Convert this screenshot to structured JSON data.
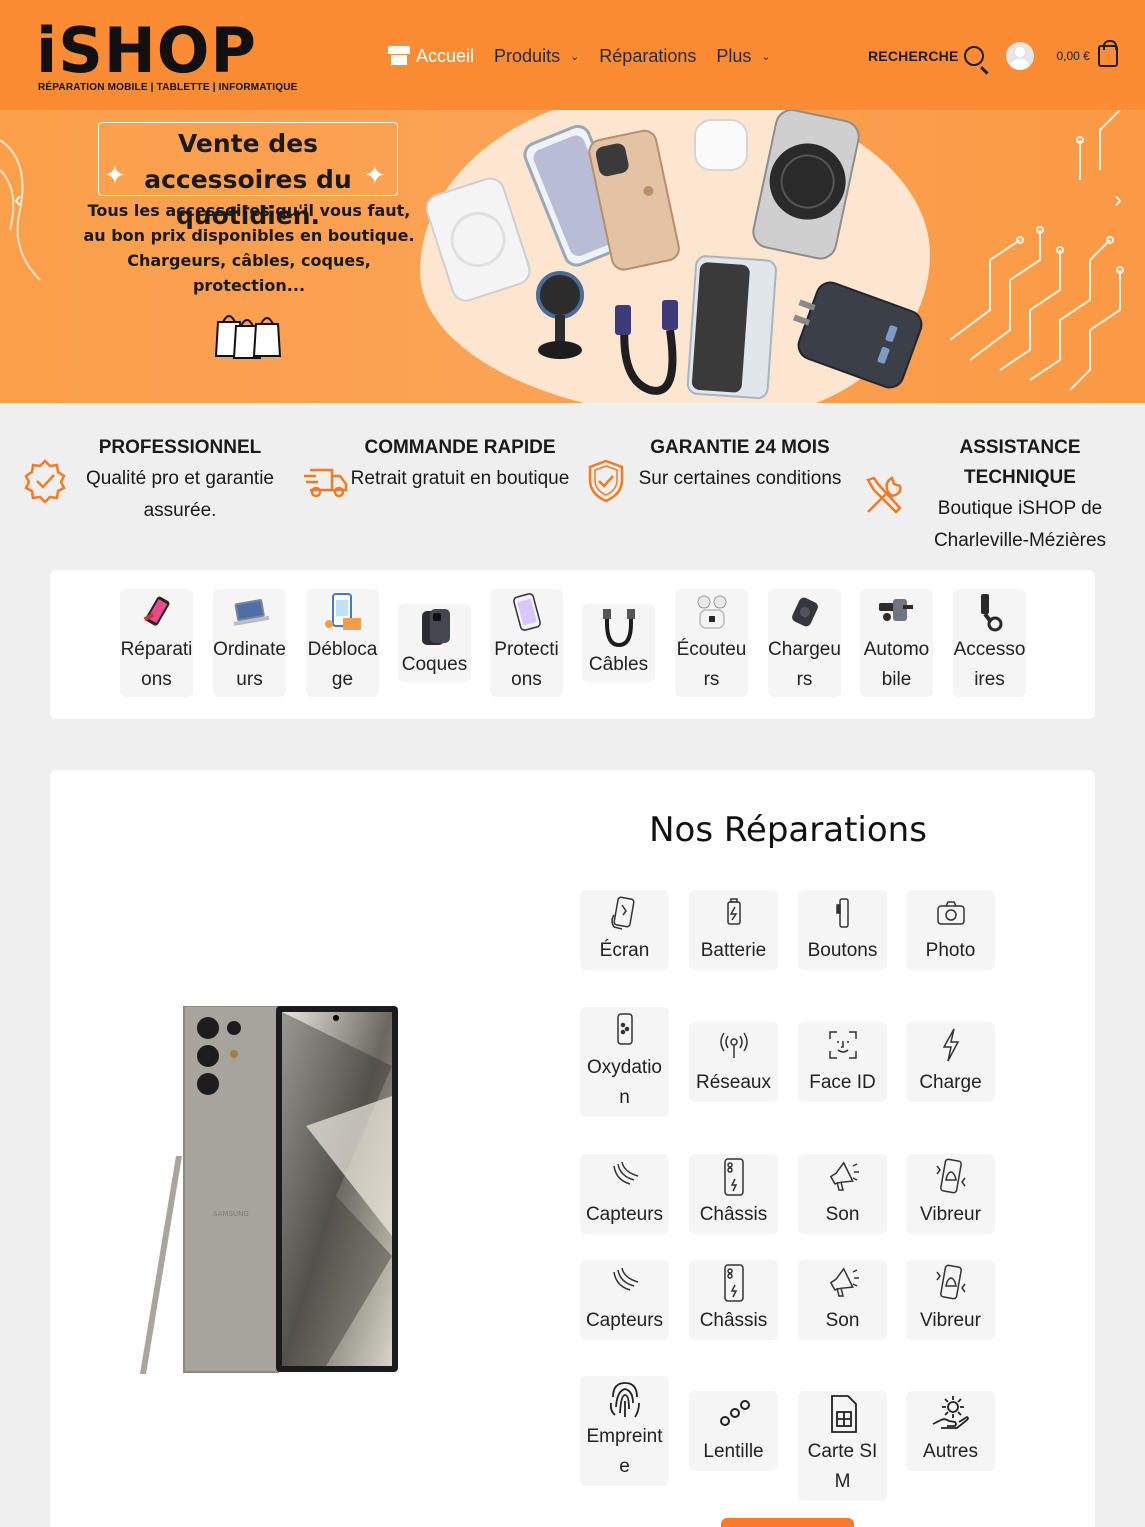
{
  "header": {
    "logo_text": "iSHOP",
    "logo_subtitle": "RÉPARATION MOBILE | TABLETTE | INFORMATIQUE",
    "nav": [
      {
        "label": "Accueil",
        "icon": "store-icon",
        "active": true
      },
      {
        "label": "Produits",
        "dropdown": true
      },
      {
        "label": "Réparations",
        "dropdown": false
      },
      {
        "label": "Plus",
        "dropdown": true
      }
    ],
    "search_label": "RECHERCHE",
    "cart_total": "0,00 €",
    "brand_color": "#fb8c33"
  },
  "hero": {
    "title": "Vente des accessoires du quotidien.",
    "text": "Tous les accessoires qu'il vous faut, au bon prix disponibles en boutique. Chargeurs, câbles, coques, protection...",
    "prev_arrow": "‹",
    "next_arrow": "›"
  },
  "features": [
    {
      "icon": "badge-check-icon",
      "title": "PROFESSIONNEL",
      "text": "Qualité pro et garantie assurée."
    },
    {
      "icon": "delivery-truck-icon",
      "title": "COMMANDE RAPIDE",
      "text": "Retrait gratuit en boutique"
    },
    {
      "icon": "shield-check-icon",
      "title": "GARANTIE 24 MOIS",
      "text": "Sur certaines conditions"
    },
    {
      "icon": "tools-icon",
      "title": "ASSISTANCE TECHNIQUE",
      "text": "Boutique iSHOP de Charleville-Mézières"
    }
  ],
  "categories": [
    {
      "label": "Réparations",
      "icon": "phone-repair-icon"
    },
    {
      "label": "Ordinateurs",
      "icon": "laptop-icon"
    },
    {
      "label": "Déblocage",
      "icon": "unlock-phone-icon"
    },
    {
      "label": "Coques",
      "icon": "phone-case-icon"
    },
    {
      "label": "Protections",
      "icon": "screen-protector-icon"
    },
    {
      "label": "Câbles",
      "icon": "cable-icon"
    },
    {
      "label": "Écouteurs",
      "icon": "earbuds-icon"
    },
    {
      "label": "Chargeurs",
      "icon": "charger-icon"
    },
    {
      "label": "Automobile",
      "icon": "car-mount-icon"
    },
    {
      "label": "Accessoires",
      "icon": "accessory-icon"
    }
  ],
  "repairs": {
    "title": "Nos Réparations",
    "items": [
      {
        "label": "Écran",
        "icon": "screen-icon"
      },
      {
        "label": "Batterie",
        "icon": "battery-icon"
      },
      {
        "label": "Boutons",
        "icon": "buttons-icon"
      },
      {
        "label": "Photo",
        "icon": "camera-icon"
      },
      {
        "label": "Oxydation",
        "icon": "water-damage-icon"
      },
      {
        "label": "Réseaux",
        "icon": "antenna-icon"
      },
      {
        "label": "Face ID",
        "icon": "face-id-icon"
      },
      {
        "label": "Charge",
        "icon": "lightning-icon"
      },
      {
        "label": "Capteurs",
        "icon": "sensor-icon"
      },
      {
        "label": "Châssis",
        "icon": "chassis-icon"
      },
      {
        "label": "Son",
        "icon": "speaker-icon"
      },
      {
        "label": "Vibreur",
        "icon": "vibration-icon"
      },
      {
        "label": "Capteurs",
        "icon": "sensor-icon"
      },
      {
        "label": "Châssis",
        "icon": "chassis-icon"
      },
      {
        "label": "Son",
        "icon": "speaker-icon"
      },
      {
        "label": "Vibreur",
        "icon": "vibration-icon"
      },
      {
        "label": "Empreinte",
        "icon": "fingerprint-icon"
      },
      {
        "label": "Lentille",
        "icon": "lens-icon"
      },
      {
        "label": "Carte SIM",
        "icon": "sim-card-icon"
      },
      {
        "label": "Autres",
        "icon": "gear-hand-icon"
      }
    ],
    "phone_brand": "SAMSUNG"
  }
}
